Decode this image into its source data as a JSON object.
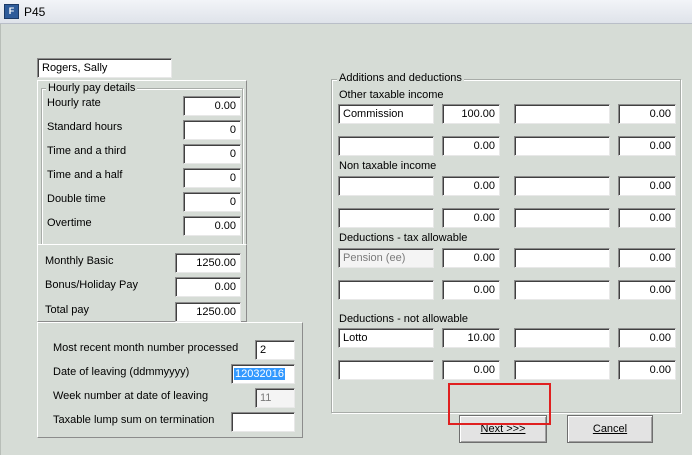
{
  "window": {
    "title": "P45",
    "icon": "p45-app-icon"
  },
  "employee": {
    "name": "Rogers, Sally"
  },
  "hourly": {
    "title": "Hourly pay details",
    "rows": [
      {
        "label": "Hourly rate",
        "value": "0.00"
      },
      {
        "label": "Standard hours",
        "value": "0"
      },
      {
        "label": "Time and a third",
        "value": "0"
      },
      {
        "label": "Time and a half",
        "value": "0"
      },
      {
        "label": "Double time",
        "value": "0"
      },
      {
        "label": "Overtime",
        "value": "0.00"
      }
    ]
  },
  "pay": {
    "rows": [
      {
        "label": "Monthly Basic",
        "value": "1250.00"
      },
      {
        "label": "Bonus/Holiday Pay",
        "value": "0.00"
      },
      {
        "label": "Total pay",
        "value": "1250.00"
      }
    ]
  },
  "leaving": {
    "rows": [
      {
        "label": "Most recent month number processed",
        "value": "2"
      },
      {
        "label": "Date of leaving (ddmmyyyy)",
        "value": "12032016"
      },
      {
        "label": "Week number at date of leaving",
        "value": "11"
      },
      {
        "label": "Taxable lump sum on termination",
        "value": ""
      }
    ]
  },
  "additions": {
    "title": "Additions and deductions",
    "sections": [
      {
        "title": "Other taxable income",
        "rows": [
          {
            "name": "Commission",
            "amount": "100.00",
            "name2": "",
            "amount2": "0.00"
          },
          {
            "name": "",
            "amount": "0.00",
            "name2": "",
            "amount2": "0.00"
          }
        ]
      },
      {
        "title": "Non taxable income",
        "rows": [
          {
            "name": "",
            "amount": "0.00",
            "name2": "",
            "amount2": "0.00"
          },
          {
            "name": "",
            "amount": "0.00",
            "name2": "",
            "amount2": "0.00"
          }
        ]
      },
      {
        "title": "Deductions - tax allowable",
        "rows": [
          {
            "name": "Pension (ee)",
            "amount": "0.00",
            "name2": "",
            "amount2": "0.00"
          },
          {
            "name": "",
            "amount": "0.00",
            "name2": "",
            "amount2": "0.00"
          }
        ]
      },
      {
        "title": "Deductions - not allowable",
        "rows": [
          {
            "name": "Lotto",
            "amount": "10.00",
            "name2": "",
            "amount2": "0.00"
          },
          {
            "name": "",
            "amount": "0.00",
            "name2": "",
            "amount2": "0.00"
          }
        ]
      }
    ]
  },
  "buttons": {
    "next": "Next >>>",
    "cancel": "Cancel"
  },
  "colors": {
    "highlight": "#e02020",
    "selection": "#3399ff"
  }
}
